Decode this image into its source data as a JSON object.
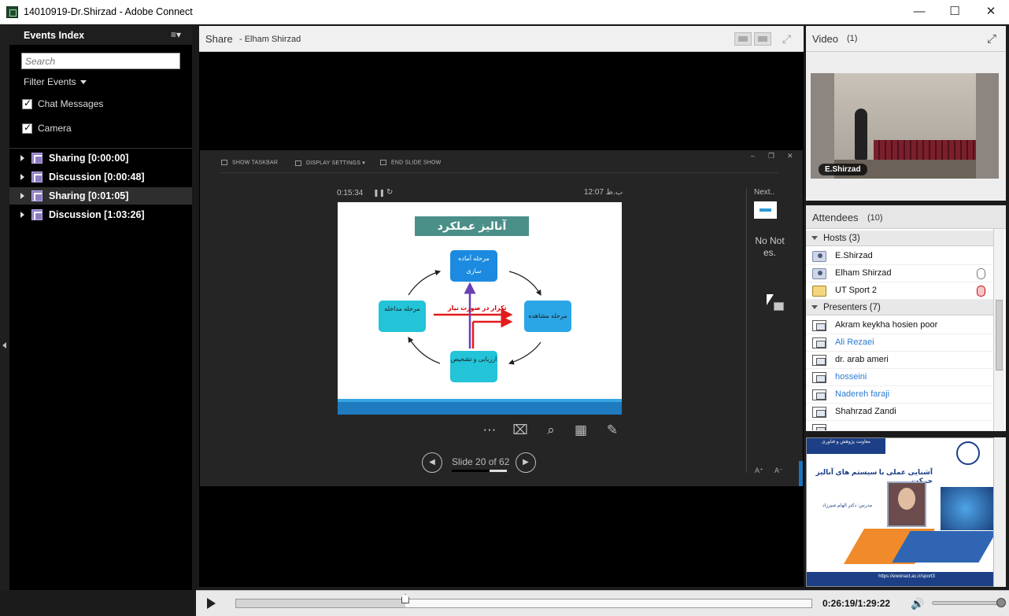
{
  "window": {
    "title": "14010919-Dr.Shirzad - Adobe Connect",
    "minimize": "—",
    "maximize": "☐",
    "close": "✕"
  },
  "events_index": {
    "title": "Events Index",
    "menu_icon": "≡▾",
    "search_placeholder": "Search",
    "filter_label": "Filter Events",
    "filters": [
      {
        "label": "Chat Messages",
        "checked": true
      },
      {
        "label": "Camera",
        "checked": true
      }
    ],
    "events": [
      {
        "label": "Sharing [0:00:00]",
        "selected": false
      },
      {
        "label": "Discussion [0:00:48]",
        "selected": false
      },
      {
        "label": "Sharing [0:01:05]",
        "selected": true
      },
      {
        "label": "Discussion [1:03:26]",
        "selected": false
      }
    ]
  },
  "share": {
    "title": "Share",
    "presenter": "- Elham Shirzad",
    "taskbar": {
      "show_taskbar": "SHOW TASKBAR",
      "display_settings": "DISPLAY SETTINGS ▾",
      "end_slide_show": "END SLIDE SHOW"
    },
    "win_controls": {
      "min": "–",
      "restore": "❐",
      "close": "✕"
    },
    "timer": "0:15:34",
    "pause_icon": "❚❚",
    "reset_icon": "↻",
    "clock": "ب.ظ 12:07",
    "next_label": "Next..",
    "notes": "No Not es.",
    "font_up": "A⁺",
    "font_down": "A⁻",
    "slide": {
      "title": "آنالیز عملکرد",
      "box_top": "مرحله آماده سازی",
      "box_left": "مرحله مداخله",
      "box_right": "مرحله مشاهده",
      "box_bottom": "ارزیابی و تشخیص",
      "note": "تکرار در صورت نیاز"
    },
    "controls": {
      "more": "⋯",
      "pen_screen": "⌧",
      "zoom": "⌕",
      "grid": "▦",
      "pen": "✎"
    },
    "slide_counter": "Slide 20 of 62",
    "prev_icon": "◀",
    "next_icon": "▶"
  },
  "video": {
    "title": "Video",
    "count": "(1)",
    "fullscreen_icon": "⤢",
    "speaker": "E.Shirzad"
  },
  "attendees": {
    "title": "Attendees",
    "count": "(10)",
    "hosts_label": "Hosts (3)",
    "hosts": [
      {
        "name": "E.Shirzad",
        "mic": "none",
        "icon": "host"
      },
      {
        "name": "Elham Shirzad",
        "mic": "active",
        "icon": "host"
      },
      {
        "name": "UT Sport 2",
        "mic": "muted",
        "icon": "sport"
      }
    ],
    "presenters_label": "Presenters (7)",
    "presenters": [
      {
        "name": "Akram keykha hosien poor",
        "link": false
      },
      {
        "name": "Ali Rezaei",
        "link": true
      },
      {
        "name": "dr. arab ameri",
        "link": false
      },
      {
        "name": "hosseini",
        "link": true
      },
      {
        "name": "Nadereh faraji",
        "link": true
      },
      {
        "name": "Shahrzad Zandi",
        "link": false
      }
    ]
  },
  "poster": {
    "header_text": "معاونت پژوهش و فناوری",
    "headline": "آشنایی عملی با سیستم های آنالیز حرکت",
    "presenter_text": "مدرس: دکتر الهام شیرزاد",
    "footer_text": "https://ewonact.ac.ir/sport3"
  },
  "playback": {
    "time": "0:26:19/1:29:22",
    "progress": 0.294,
    "volume": 1.0,
    "volume_icon": "🔊"
  },
  "colors": {
    "accent_blue": "#1f7ac0",
    "event_icon": "#8e7cc3",
    "link_blue": "#2b7bd0"
  }
}
